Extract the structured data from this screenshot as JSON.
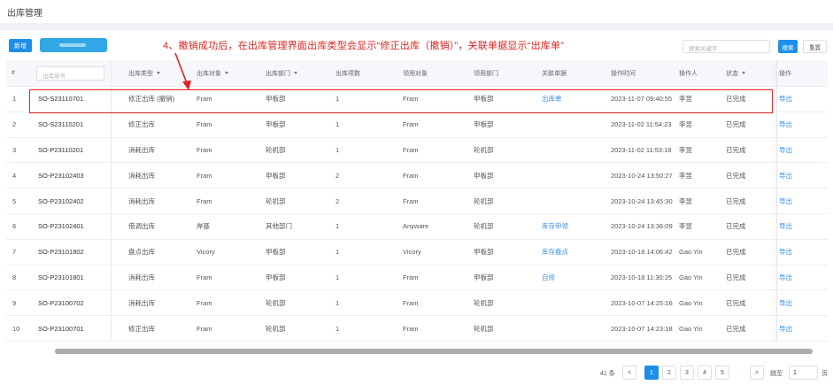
{
  "page": {
    "title": "出库管理"
  },
  "toolbar": {
    "new_label": "新增"
  },
  "annotation": {
    "text": "4、撤销成功后，在出库管理界面出库类型会显示“修正出库（撤销）”，关联单据显示“出库单”",
    "color": "#e0231f"
  },
  "search": {
    "placeholder": "搜索关键字",
    "search_label": "搜索",
    "reset_label": "重置"
  },
  "table": {
    "headers": {
      "index": "#",
      "order_no_placeholder": "出库单号",
      "type": "出库类型",
      "object": "出库对象",
      "dept": "出库部门",
      "items": "出库项数",
      "recv_obj": "领用对象",
      "recv_dept": "领用部门",
      "related": "关联单据",
      "time": "操作时间",
      "operator": "操作人",
      "status": "状态",
      "action": "操作"
    },
    "rows": [
      {
        "idx": "1",
        "order_no": "SO-S23110701",
        "type": "修正出库 (撤销)",
        "object": "Fram",
        "dept": "甲板部",
        "items": "1",
        "recv_obj": "Fram",
        "recv_dept": "甲板部",
        "related": "出库单",
        "time": "2023-11-07 09:40:55",
        "operator": "李昱",
        "status": "已完成",
        "action": "导出"
      },
      {
        "idx": "2",
        "order_no": "SO-S23110201",
        "type": "修正出库",
        "object": "Fram",
        "dept": "甲板部",
        "items": "1",
        "recv_obj": "Fram",
        "recv_dept": "甲板部",
        "related": "",
        "time": "2023-11-02 11:54:23",
        "operator": "李昱",
        "status": "已完成",
        "action": "导出"
      },
      {
        "idx": "3",
        "order_no": "SO-P23110201",
        "type": "消耗出库",
        "object": "Fram",
        "dept": "轮机部",
        "items": "1",
        "recv_obj": "Fram",
        "recv_dept": "轮机部",
        "related": "",
        "time": "2023-11-02 11:53:18",
        "operator": "李昱",
        "status": "已完成",
        "action": "导出"
      },
      {
        "idx": "4",
        "order_no": "SO-P23102403",
        "type": "消耗出库",
        "object": "Fram",
        "dept": "甲板部",
        "items": "2",
        "recv_obj": "Fram",
        "recv_dept": "甲板部",
        "related": "",
        "time": "2023-10-24 13:50:27",
        "operator": "李昱",
        "status": "已完成",
        "action": "导出"
      },
      {
        "idx": "5",
        "order_no": "SO-P23102402",
        "type": "消耗出库",
        "object": "Fram",
        "dept": "轮机部",
        "items": "2",
        "recv_obj": "Fram",
        "recv_dept": "轮机部",
        "related": "",
        "time": "2023-10-24 13:45:30",
        "operator": "李昱",
        "status": "已完成",
        "action": "导出"
      },
      {
        "idx": "6",
        "order_no": "SO-P23102401",
        "type": "借调出库",
        "object": "岸基",
        "dept": "其他部门",
        "items": "1",
        "recv_obj": "Anyware",
        "recv_dept": "轮机部",
        "related": "库存申领",
        "time": "2023-10-24 13:36:09",
        "operator": "李昱",
        "status": "已完成",
        "action": "导出"
      },
      {
        "idx": "7",
        "order_no": "SO-P23101802",
        "type": "盘点出库",
        "object": "Vicory",
        "dept": "甲板部",
        "items": "1",
        "recv_obj": "Vicory",
        "recv_dept": "甲板部",
        "related": "库存盘点",
        "time": "2023-10-18 14:06:42",
        "operator": "Gao Yin",
        "status": "已完成",
        "action": "导出"
      },
      {
        "idx": "8",
        "order_no": "SO-P23101801",
        "type": "消耗出库",
        "object": "Fram",
        "dept": "甲板部",
        "items": "1",
        "recv_obj": "Fram",
        "recv_dept": "甲板部",
        "related": "自修",
        "time": "2023-10-18 11:30:25",
        "operator": "Gao Yin",
        "status": "已完成",
        "action": "导出"
      },
      {
        "idx": "9",
        "order_no": "SO-P23100702",
        "type": "消耗出库",
        "object": "Fram",
        "dept": "轮机部",
        "items": "1",
        "recv_obj": "Fram",
        "recv_dept": "轮机部",
        "related": "",
        "time": "2023-10-07 14:25:16",
        "operator": "Gao Yin",
        "status": "已完成",
        "action": "导出"
      },
      {
        "idx": "10",
        "order_no": "SO-P23100701",
        "type": "修正出库",
        "object": "Fram",
        "dept": "轮机部",
        "items": "1",
        "recv_obj": "Fram",
        "recv_dept": "轮机部",
        "related": "",
        "time": "2023-10-07 14:23:18",
        "operator": "Gao Yin",
        "status": "已完成",
        "action": "导出"
      }
    ]
  },
  "pagination": {
    "total": "41 条",
    "prev": "<",
    "pages": [
      "1",
      "2",
      "3",
      "4",
      "5"
    ],
    "active_page": "1",
    "next": ">",
    "goto_label": "跳至",
    "goto_value": "1",
    "goto_unit": "页"
  },
  "colors": {
    "primary": "#1e8fe8",
    "link": "#3a8ee6",
    "annotation": "#e0231f"
  }
}
